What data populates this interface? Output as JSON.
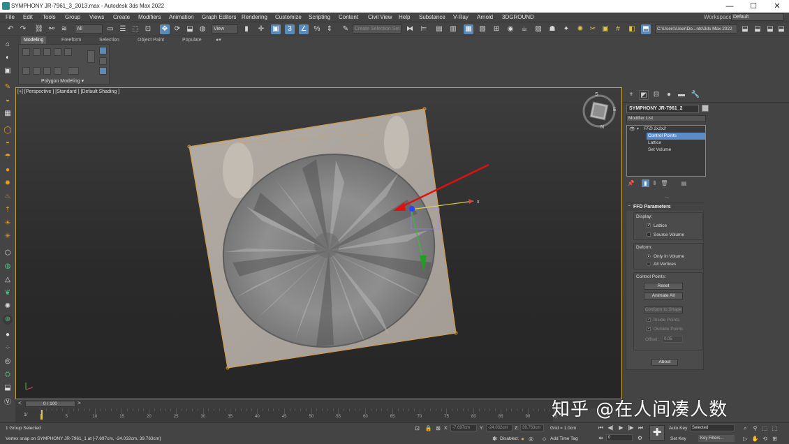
{
  "titlebar": {
    "title": "SYMPHONY JR-7961_3_2013.max - Autodesk 3ds Max 2022",
    "minimize": "—",
    "maximize": "☐",
    "close": "✕"
  },
  "menu": [
    "File",
    "Edit",
    "Tools",
    "Group",
    "Views",
    "Create",
    "Modifiers",
    "Animation",
    "Graph Editors",
    "Rendering",
    "Customize",
    "Scripting",
    "Content",
    "Civil View",
    "Help",
    "Substance",
    "V-Ray",
    "Arnold",
    "3DGROUND"
  ],
  "workspaces": {
    "label": "Workspaces:",
    "value": "Default"
  },
  "toolbar": {
    "filter": "All",
    "refcoord": "View",
    "selset": "Create Selection Set",
    "path": "C:\\Users\\User\\Do...nts\\3ds Max 2022"
  },
  "ribbon": {
    "tabs": [
      "Modeling",
      "Freeform",
      "Selection",
      "Object Paint",
      "Populate"
    ],
    "panel": "Polygon Modeling ▾"
  },
  "viewport": {
    "label": "[+] [Perspective ] [Standard ] [Default Shading ]",
    "gizmo_x": "x",
    "viewcube": {
      "s": "S",
      "e": "E",
      "n": "N"
    }
  },
  "command": {
    "object_name": "SYMPHONY JR-7961_2",
    "modifier_list": "Modifier List",
    "stack": [
      {
        "label": "FFD 2x2x2",
        "selected": false
      },
      {
        "label": "Control Points",
        "selected": true
      },
      {
        "label": "Lattice",
        "selected": false
      },
      {
        "label": "Set Volume",
        "selected": false
      }
    ],
    "ffd": {
      "title": "FFD Parameters",
      "display_label": "Display:",
      "lattice": "Lattice",
      "source_volume": "Source Volume",
      "deform_label": "Deform:",
      "only_in_volume": "Only In Volume",
      "all_vertices": "All Vertices",
      "cp_label": "Control Points:",
      "reset": "Reset",
      "animate_all": "Animate All",
      "conform": "Conform to Shape",
      "inside_points": "Inside Points",
      "outside_points": "Outside Points",
      "offset_label": "Offset :",
      "offset_value": "0.05",
      "about": "About"
    }
  },
  "timeline": {
    "thumb": "0 / 100",
    "ticks": [
      "5",
      "10",
      "15",
      "20",
      "25",
      "30",
      "35",
      "40",
      "45",
      "50",
      "55",
      "60",
      "65",
      "70",
      "75",
      "80",
      "85",
      "90",
      "95"
    ]
  },
  "status": {
    "selected": "1 Group Selected",
    "prompt": "Vertex snap on SYMPHONY JR-7961_1 at [-7.697cm, -24.032cm, 39.763cm]",
    "x_label": "X:",
    "x_value": "-7.697cm",
    "y_label": "Y:",
    "y_value": "-24.032cm",
    "z_label": "Z:",
    "z_value": "39.763cm",
    "grid": "Grid = 1.0cm",
    "disabled": "Disabled:",
    "add_time_tag": "Add Time Tag",
    "auto_key": "Auto Key",
    "set_key": "Set Key",
    "key_selected": "Selected",
    "key_filters": "Key Filters...",
    "frame": "0"
  },
  "watermark": "知乎 @在人间凑人数"
}
